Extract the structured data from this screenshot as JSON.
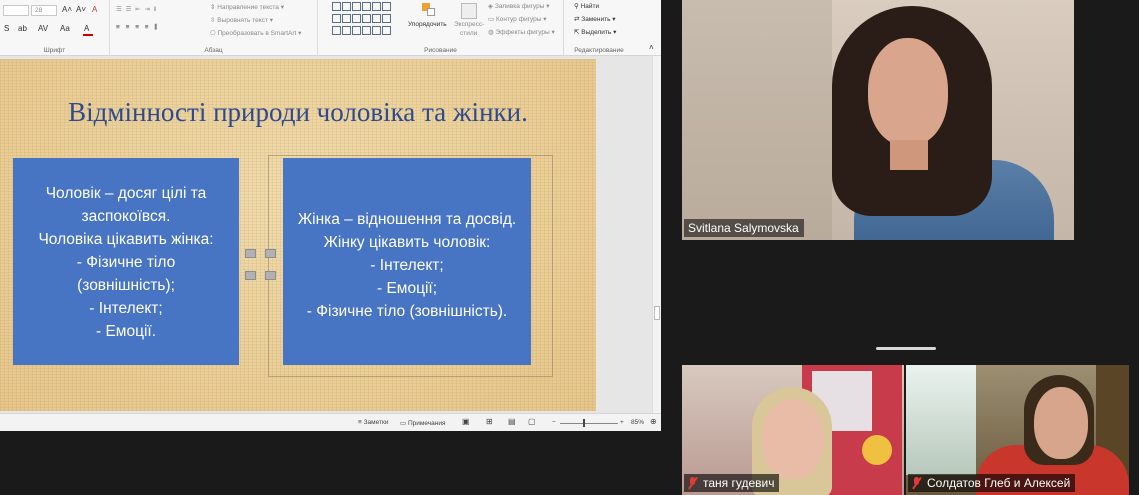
{
  "ribbon": {
    "font_size": "28",
    "groups": {
      "font": "Шрифт",
      "paragraph": "Абзац",
      "drawing": "Рисование",
      "editing": "Редактирование"
    },
    "paragraph": {
      "text_direction": "Направление текста",
      "align_text": "Выровнять текст",
      "smartart": "Преобразовать в SmartArt"
    },
    "drawing": {
      "arrange": "Упорядочить",
      "quick_styles_1": "Экспресс-",
      "quick_styles_2": "стили",
      "shape_fill": "Заливка фигуры",
      "shape_outline": "Контур фигуры",
      "shape_effects": "Эффекты фигуры"
    },
    "editing": {
      "find": "Найти",
      "replace": "Заменить",
      "select": "Выделить"
    }
  },
  "slide": {
    "title": "Відмінності природи чоловіка та жінки.",
    "left_box": [
      "Чоловік – досяг цілі та",
      "заспокоївся.",
      "Чоловіка цікавить жінка:",
      "- Фізичне тіло",
      "(зовнішність);",
      "-  Інтелект;",
      "-  Емоції."
    ],
    "right_box": [
      "Жінка – відношення та досвід.",
      "Жінку цікавить чоловік:",
      "-  Інтелект;",
      "-  Емоції;",
      "-  Фізичне тіло (зовнішність)."
    ]
  },
  "status_bar": {
    "notes": "Заметки",
    "comments": "Примечания",
    "zoom": "85%"
  },
  "participants": {
    "main": "Svitlana Salymovska",
    "p2": "таня гудевич",
    "p3": "Солдатов Глеб и Алексей"
  },
  "colors": {
    "slide_box": "#4874c4",
    "slide_title": "#2e4a8f",
    "muted_mic": "#e03a3a"
  }
}
